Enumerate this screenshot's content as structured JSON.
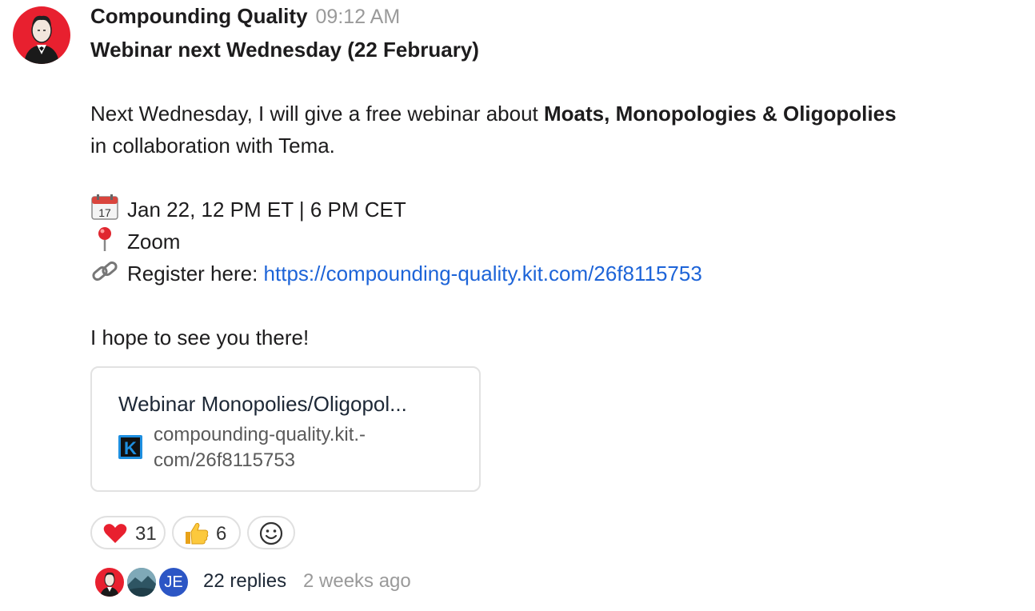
{
  "message": {
    "author": "Compounding Quality",
    "time": "09:12 AM",
    "title": "Webinar next Wednesday (22 February)",
    "intro_prefix": "Next Wednesday, I will give a free webinar about ",
    "intro_bold": "Moats, Monopologies & Oligopolies",
    "intro_suffix": "in collaboration with Tema.",
    "date_emoji": "calendar-icon",
    "date_text": "Jan 22, 12 PM ET | 6 PM CET",
    "location_emoji": "pin-icon",
    "location_text": "Zoom",
    "register_emoji": "link-icon",
    "register_label": "Register here: ",
    "register_url": "https://compounding-quality.kit.com/26f8115753",
    "closing": "I hope to see you there!"
  },
  "link_preview": {
    "title": "Webinar Monopolies/Oligopol...",
    "logo_letter": "K",
    "url_line1": "compounding-quality.kit.-",
    "url_line2": "com/26f8115753"
  },
  "reactions": [
    {
      "icon": "heart-icon",
      "count": "31"
    },
    {
      "icon": "thumbs-up-icon",
      "count": "6"
    }
  ],
  "thread": {
    "avatars": [
      "person-avatar",
      "landscape-avatar",
      "JE"
    ],
    "replies_label": "22 replies",
    "last_reply": "2 weeks ago"
  },
  "colors": {
    "link": "#1d64d8",
    "avatar_bg": "#e8202f",
    "kit_logo": "#1e8fe0",
    "je_avatar": "#2c56c5"
  }
}
